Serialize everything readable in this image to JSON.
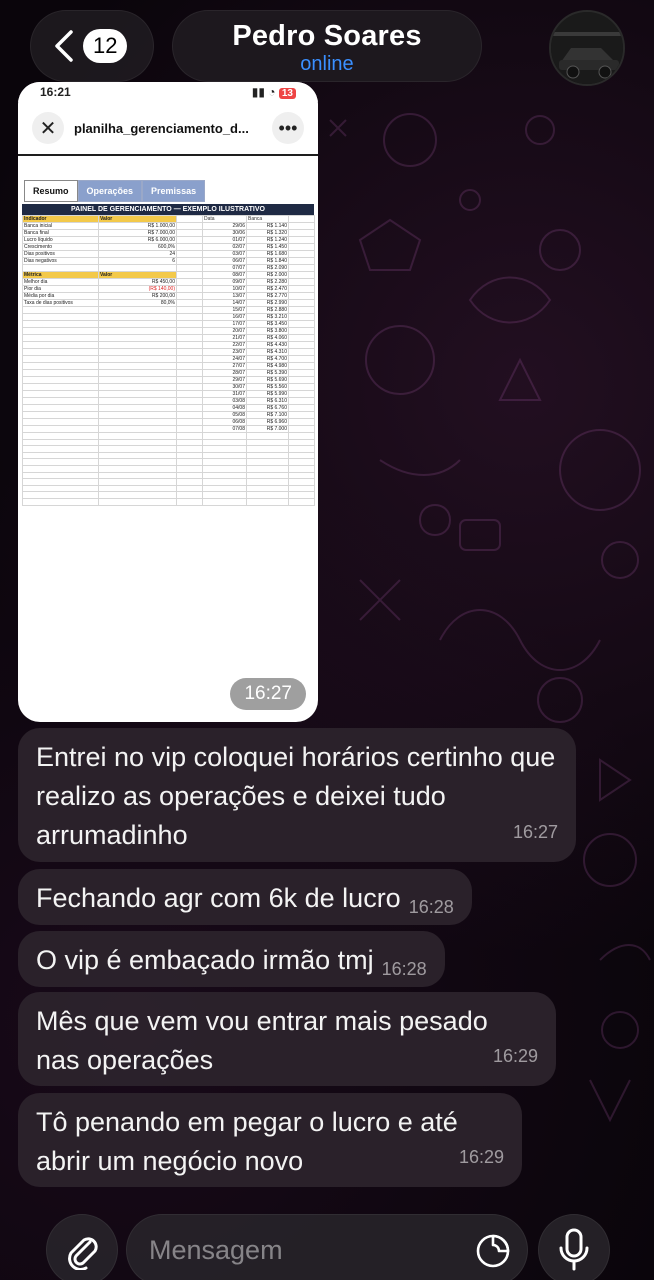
{
  "header": {
    "back_count": "12",
    "contact_name": "Pedro Soares",
    "contact_status": "online"
  },
  "image_message": {
    "status_time": "16:21",
    "battery": "13",
    "file_name": "planilha_gerenciamento_d...",
    "tabs": [
      "Resumo",
      "Operações",
      "Premissas"
    ],
    "sheet_title": "PAINEL DE GERENCIAMENTO — EXEMPLO ILUSTRATIVO",
    "indicators_header": [
      "Indicador",
      "Valor"
    ],
    "indicators": [
      [
        "Banca inicial",
        "R$ 1.000,00"
      ],
      [
        "Banca final",
        "R$ 7.000,00"
      ],
      [
        "Lucro líquido",
        "R$ 6.000,00"
      ],
      [
        "Crescimento",
        "600,0%"
      ],
      [
        "Dias positivos",
        "24"
      ],
      [
        "Dias negativos",
        "6"
      ]
    ],
    "metrics_header": [
      "Métrica",
      "Valor"
    ],
    "metrics": [
      [
        "Melhor dia",
        "R$ 450,00"
      ],
      [
        "Pior dia",
        "(R$ 140,00)"
      ],
      [
        "Média por dia",
        "R$ 200,00"
      ],
      [
        "Taxa de dias positivos",
        "80,0%"
      ]
    ],
    "series_header": [
      "Data",
      "Banca"
    ],
    "series": [
      [
        "29/06",
        "R$ 1.140"
      ],
      [
        "30/06",
        "R$ 1.320"
      ],
      [
        "01/07",
        "R$ 1.240"
      ],
      [
        "02/07",
        "R$ 1.450"
      ],
      [
        "03/07",
        "R$ 1.680"
      ],
      [
        "06/07",
        "R$ 1.840"
      ],
      [
        "07/07",
        "R$ 2.090"
      ],
      [
        "08/07",
        "R$ 2.000"
      ],
      [
        "09/07",
        "R$ 2.280"
      ],
      [
        "10/07",
        "R$ 2.470"
      ],
      [
        "13/07",
        "R$ 2.770"
      ],
      [
        "14/07",
        "R$ 2.990"
      ],
      [
        "15/07",
        "R$ 2.880"
      ],
      [
        "16/07",
        "R$ 3.210"
      ],
      [
        "17/07",
        "R$ 3.450"
      ],
      [
        "20/07",
        "R$ 3.800"
      ],
      [
        "21/07",
        "R$ 4.060"
      ],
      [
        "22/07",
        "R$ 4.430"
      ],
      [
        "23/07",
        "R$ 4.310"
      ],
      [
        "24/07",
        "R$ 4.700"
      ],
      [
        "27/07",
        "R$ 4.980"
      ],
      [
        "28/07",
        "R$ 5.390"
      ],
      [
        "29/07",
        "R$ 5.690"
      ],
      [
        "30/07",
        "R$ 5.560"
      ],
      [
        "31/07",
        "R$ 5.990"
      ],
      [
        "03/08",
        "R$ 6.310"
      ],
      [
        "04/08",
        "R$ 6.760"
      ],
      [
        "05/08",
        "R$ 7.100"
      ],
      [
        "06/08",
        "R$ 6.960"
      ],
      [
        "07/08",
        "R$ 7.000"
      ]
    ],
    "time": "16:27"
  },
  "messages": [
    {
      "text": "Entrei no vip coloquei horários certinho que realizo as operações e deixei tudo arrumadinho",
      "time": "16:27"
    },
    {
      "text": "Fechando agr com 6k de lucro",
      "time": "16:28"
    },
    {
      "text": "O vip é embaçado irmão tmj",
      "time": "16:28"
    },
    {
      "text": "Mês que vem vou entrar mais pesado nas operações",
      "time": "16:29"
    },
    {
      "text": "Tô penando em pegar o lucro e até abrir um negócio novo",
      "time": "16:29"
    }
  ],
  "composer": {
    "placeholder": "Mensagem"
  },
  "colors": {
    "accent": "#3a8fff",
    "bubble": "#2c222c",
    "background": "#0a050b",
    "sheet_header": "#f3c94a",
    "sheet_title_bg": "#1f2a44"
  }
}
